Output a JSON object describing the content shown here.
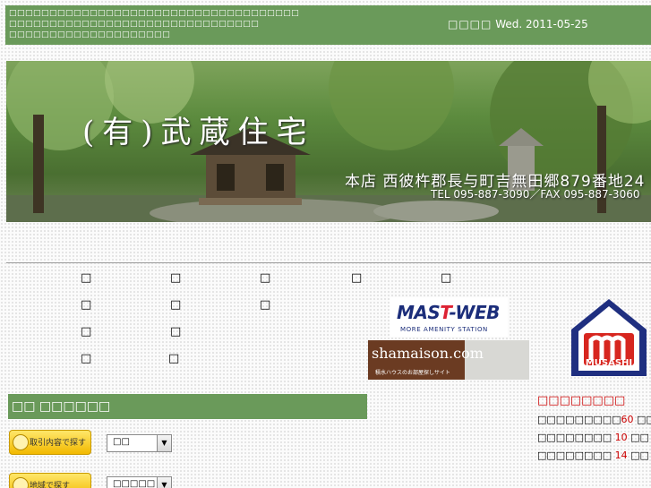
{
  "topbar": {
    "message_line1": "□□□□□□□□□□□□□□□□□□□□□□□□□□□□□□□□□□□□",
    "message_line2": "□□□□□□□□□□□□□□□□□□□□□□□□□□□□□□□",
    "message_line3": "□□□□□□□□□□□□□□□□□□□□",
    "date_label": "□□□□",
    "date_value": "Wed. 2011-05-25"
  },
  "banner": {
    "company": "(有)武蔵住宅",
    "address": "本店 西彼杵郡長与町吉無田郷879番地24",
    "tel": "TEL 095-887-3090／FAX 095-887-3060"
  },
  "nav": {
    "items": [
      "□",
      "□",
      "□",
      "□",
      "□",
      "□",
      "□",
      "□",
      "□",
      "□",
      "□",
      "□",
      "□"
    ]
  },
  "partners": {
    "mast_title_a": "MAS",
    "mast_title_b": "T",
    "mast_title_c": "-WEB",
    "mast_sub": "MORE AMENITY STATION",
    "shamaison_title": "shamaison.com",
    "shamaison_sub": "積水ハウスのお部屋探しサイト",
    "musashi_label": "MUSASHI"
  },
  "search": {
    "header": "□□ □□□□□□",
    "by_transaction_label": "取引内容で探す",
    "by_transaction_value": "□□",
    "by_area_label": "地域で探す",
    "by_area_value": "□□□□□"
  },
  "stats": {
    "title": "□□□□□□□□",
    "rows": [
      {
        "label": "□□□□□□□□□",
        "value": "60",
        "unit": "□□"
      },
      {
        "label": "□□□□□□□□",
        "value": "10",
        "unit": "□□"
      },
      {
        "label": "□□□□□□□□",
        "value": "14",
        "unit": "□□"
      }
    ]
  },
  "colors": {
    "accent_green": "#6a9a5a",
    "stat_red": "#cc0000"
  }
}
